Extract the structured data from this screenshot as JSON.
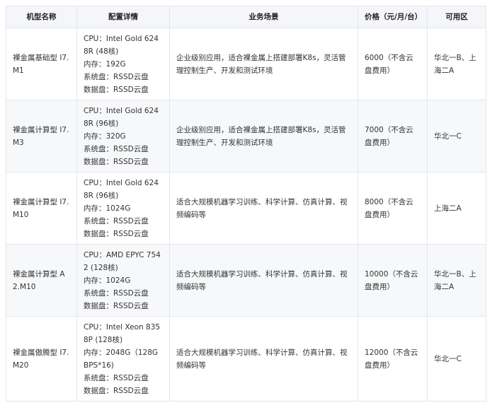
{
  "table": {
    "headers": [
      "机型名称",
      "配置详情",
      "业务场景",
      "价格（元/月/台）",
      "可用区"
    ],
    "rows": [
      {
        "name": "裸金属基础型 I7.M1",
        "config": [
          "CPU：Intel Gold 6248R (48核)",
          "内存：192G",
          "系统盘：RSSD云盘",
          "数据盘：RSSD云盘"
        ],
        "scenario": "企业级别应用，适合裸金属上搭建部署K8s，灵活管理控制生产、开发和测试环境",
        "price": "6000（不含云盘费用）",
        "zone": "华北一B、上海二A"
      },
      {
        "name": "裸金属计算型 I7.M3",
        "config": [
          "CPU：Intel Gold 6248R (96核)",
          "内存：320G",
          "系统盘：RSSD云盘",
          "数据盘：RSSD云盘"
        ],
        "scenario": "企业级别应用，适合裸金属上搭建部署K8s，灵活管理控制生产、开发和测试环境",
        "price": "7000（不含云盘费用）",
        "zone": "华北一C"
      },
      {
        "name": "裸金属计算型 I7.M10",
        "config": [
          "CPU：Intel Gold 6248R (96核)",
          "内存：1024G",
          "系统盘：RSSD云盘",
          "数据盘：RSSD云盘"
        ],
        "scenario": "适合大规模机器学习训练、科学计算、仿真计算、视频编码等",
        "price": "8000（不含云盘费用）",
        "zone": "上海二A"
      },
      {
        "name": "裸金属计算型 A2.M10",
        "config": [
          "CPU：AMD EPYC 7542 (128核)",
          "内存：1024G",
          "系统盘：RSSD云盘",
          "数据盘：RSSD云盘"
        ],
        "scenario": "适合大规模机器学习训练、科学计算、仿真计算、视频编码等",
        "price": "10000（不含云盘费用）",
        "zone": "华北一B、上海二A"
      },
      {
        "name": "裸金属傲腾型 I7.M20",
        "config": [
          "CPU：Intel Xeon 8358P (128核)",
          "内存：2048G（128G BPS*16)",
          "系统盘：RSSD云盘",
          "数据盘：RSSD云盘"
        ],
        "scenario": "适合大规模机器学习训练、科学计算、仿真计算、视频编码等",
        "price": "12000（不含云盘费用）",
        "zone": "华北一C"
      }
    ]
  }
}
